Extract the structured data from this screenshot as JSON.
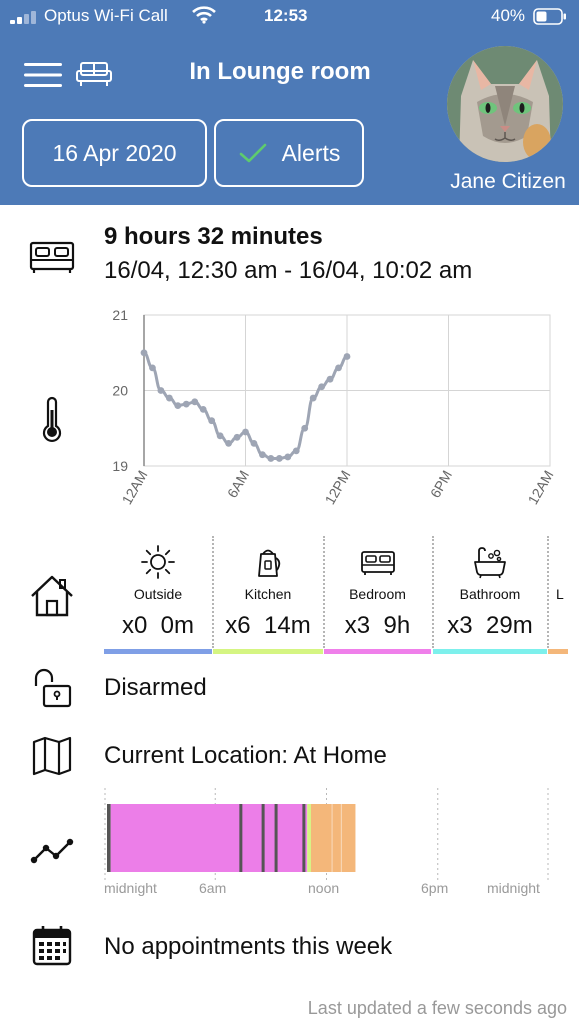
{
  "status_bar": {
    "carrier": "Optus Wi-Fi Call",
    "time": "12:53",
    "battery": "40%"
  },
  "header": {
    "title": "In Lounge room",
    "date": "16 Apr 2020",
    "alerts_label": "Alerts",
    "user_name": "Jane Citizen"
  },
  "sleep": {
    "duration": "9 hours 32 minutes",
    "range": "16/04, 12:30 am - 16/04, 10:02 am"
  },
  "chart_data": {
    "type": "line",
    "xlabel": "",
    "ylabel": "",
    "ylim": [
      19,
      21
    ],
    "x_ticks": [
      "12AM",
      "6AM",
      "12PM",
      "6PM",
      "12AM"
    ],
    "y_ticks": [
      "19",
      "20",
      "21"
    ],
    "x_range_hours": [
      0,
      24
    ],
    "grid": true,
    "series": [
      {
        "x": [
          0,
          0.5,
          1.0,
          1.5,
          2.0,
          2.5,
          3.0,
          3.5,
          4.0,
          4.5,
          5.0,
          5.5,
          6.0,
          6.5,
          7.0,
          7.5,
          8.0,
          8.5,
          9.0,
          9.5,
          10.0,
          10.5,
          11.0,
          11.5,
          12.0
        ],
        "y": [
          20.5,
          20.3,
          20.0,
          19.9,
          19.8,
          19.82,
          19.85,
          19.75,
          19.6,
          19.4,
          19.3,
          19.38,
          19.45,
          19.3,
          19.15,
          19.1,
          19.1,
          19.12,
          19.2,
          19.5,
          19.9,
          20.05,
          20.15,
          20.3,
          20.45
        ],
        "markers": true,
        "color": "#9ea5b4"
      }
    ]
  },
  "rooms": [
    {
      "name": "Outside",
      "count": "x0",
      "time": "0m",
      "color": "#7f9fe6",
      "icon": "sun-icon"
    },
    {
      "name": "Kitchen",
      "count": "x6",
      "time": "14m",
      "color": "#d5f582",
      "icon": "kettle-icon"
    },
    {
      "name": "Bedroom",
      "count": "x3",
      "time": "9h",
      "color": "#ef7fea",
      "icon": "bed-icon"
    },
    {
      "name": "Bathroom",
      "count": "x3",
      "time": "29m",
      "color": "#7df0ec",
      "icon": "bathtub-icon"
    },
    {
      "name": "L",
      "color": "#f4b77a"
    }
  ],
  "security": {
    "status": "Disarmed"
  },
  "location": {
    "text": "Current Location: At Home"
  },
  "timeline": {
    "labels": [
      "midnight",
      "6am",
      "noon",
      "6pm",
      "midnight"
    ],
    "segments": [
      {
        "from_hour": 0,
        "to_hour": 0.2,
        "color": "#555555"
      },
      {
        "from_hour": 0.2,
        "to_hour": 10.8,
        "color": "#ec7ee8"
      },
      {
        "from_hour": 10.8,
        "to_hour": 11.0,
        "color": "#d5f582"
      },
      {
        "from_hour": 11.0,
        "to_hour": 13.4,
        "color": "#f4b77a"
      }
    ],
    "markers_hour": [
      7.3,
      8.5,
      9.2,
      10.7
    ],
    "marker_color": "#555555"
  },
  "appointments": {
    "text": "No appointments this week"
  },
  "footer": {
    "last_updated": "Last updated a few seconds ago"
  }
}
